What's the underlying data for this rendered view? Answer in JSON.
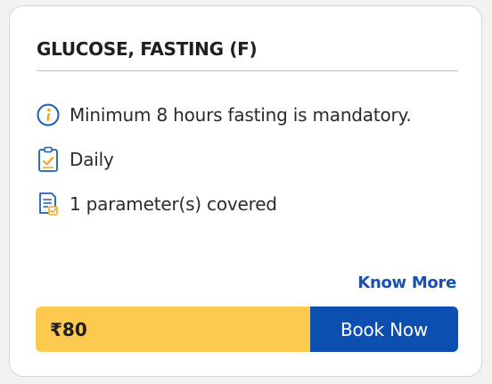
{
  "card": {
    "title": "GLUCOSE, FASTING (F)",
    "info": [
      {
        "icon": "info-icon",
        "text": "Minimum 8 hours fasting is mandatory."
      },
      {
        "icon": "clipboard-check-icon",
        "text": "Daily"
      },
      {
        "icon": "report-icon",
        "text": "1 parameter(s) covered"
      }
    ],
    "know_more_label": "Know More",
    "price": "₹80",
    "book_label": "Book Now"
  },
  "colors": {
    "price_background": "#fdc94e",
    "book_background": "#0b4fb0",
    "link": "#1652b4",
    "icon_outline": "#1d5fb8",
    "icon_accent": "#f5a623"
  }
}
